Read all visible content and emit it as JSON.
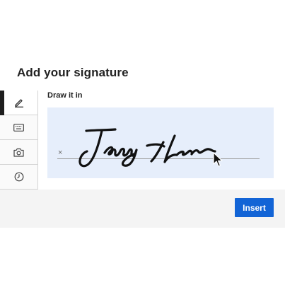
{
  "dialog": {
    "title": "Add your signature",
    "mode_label": "Draw it in",
    "tabs": [
      {
        "name": "draw",
        "icon": "pencil-icon",
        "active": true
      },
      {
        "name": "type",
        "icon": "keyboard-icon",
        "active": false
      },
      {
        "name": "photo",
        "icon": "camera-icon",
        "active": false
      },
      {
        "name": "recent",
        "icon": "clock-icon",
        "active": false
      }
    ],
    "clear_label": "×",
    "insert_label": "Insert",
    "colors": {
      "accent": "#1264d6",
      "canvas": "#e6eefb",
      "ink": "#111111"
    }
  }
}
